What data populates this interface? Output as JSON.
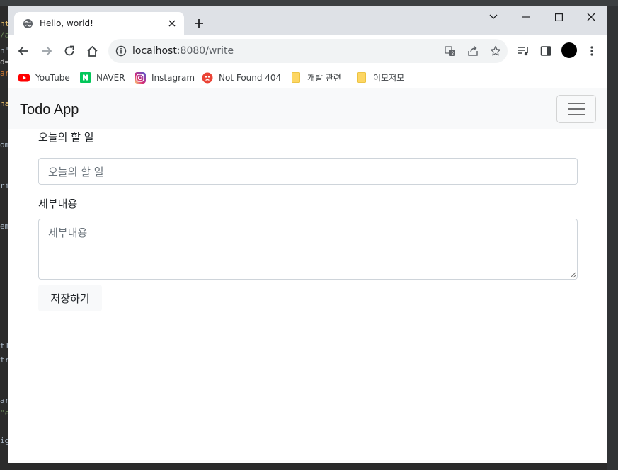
{
  "editor": {
    "fragments": [
      {
        "text": "ht",
        "color": "#e8bf6a"
      },
      {
        "text": "/a",
        "color": "#6a8759"
      },
      {
        "text": "n\"",
        "color": "#a9b7c6"
      },
      {
        "text": "d=",
        "color": "#bababa"
      },
      {
        "text": "ar",
        "color": "#cc7832"
      },
      {
        "text": "na",
        "color": "#e8bf6a"
      },
      {
        "text": "om",
        "color": "#a9b7c6"
      },
      {
        "text": "ri",
        "color": "#a9b7c6"
      },
      {
        "text": "em",
        "color": "#a9b7c6"
      },
      {
        "text": "t1",
        "color": "#a9b7c6"
      },
      {
        "text": "tr",
        "color": "#a9b7c6"
      },
      {
        "text": "ar",
        "color": "#a9b7c6"
      },
      {
        "text": "\"e",
        "color": "#6a8759"
      },
      {
        "text": "ig",
        "color": "#a9b7c6"
      }
    ]
  },
  "browser": {
    "tab_title": "Hello, world!",
    "url_host": "localhost",
    "url_path": ":8080/write",
    "bookmarks": [
      {
        "label": "YouTube",
        "icon": "youtube-icon",
        "color": "#ff0000"
      },
      {
        "label": "NAVER",
        "icon": "naver-icon",
        "color": "#03c75a"
      },
      {
        "label": "Instagram",
        "icon": "instagram-icon",
        "color": "#e1306c"
      },
      {
        "label": "Not Found 404",
        "icon": "notfound-icon",
        "color": "#ea4335"
      },
      {
        "label": "개발 관련",
        "icon": "folder-icon",
        "color": "#fdd663"
      },
      {
        "label": "이모저모",
        "icon": "folder-icon",
        "color": "#fdd663"
      }
    ]
  },
  "app": {
    "brand": "Todo App",
    "form": {
      "title_label": "오늘의 할 일",
      "title_placeholder": "오늘의 할 일",
      "detail_label": "세부내용",
      "detail_placeholder": "세부내용",
      "save_label": "저장하기"
    }
  },
  "colors": {
    "navbar_bg": "#f8f9fa",
    "chrome_frame": "#dee1e6",
    "input_border": "#ced4da"
  }
}
